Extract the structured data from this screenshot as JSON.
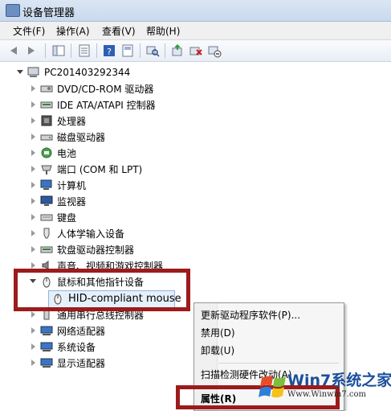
{
  "window": {
    "title": "设备管理器"
  },
  "menu": [
    "文件(F)",
    "操作(A)",
    "查看(V)",
    "帮助(H)"
  ],
  "tree": {
    "root": "PC201403292344",
    "categories": [
      "DVD/CD-ROM 驱动器",
      "IDE ATA/ATAPI 控制器",
      "处理器",
      "磁盘驱动器",
      "电池",
      "端口 (COM 和 LPT)",
      "计算机",
      "监视器",
      "键盘",
      "人体学输入设备",
      "软盘驱动器控制器",
      "声音、视频和游戏控制器",
      "鼠标和其他指针设备",
      "通用串行总线控制器",
      "网络适配器",
      "系统设备",
      "显示适配器"
    ],
    "selected_child": "HID-compliant mouse"
  },
  "context_menu": {
    "items": [
      "更新驱动程序软件(P)...",
      "禁用(D)",
      "卸载(U)",
      "扫描检测硬件改动(A)",
      "属性(R)"
    ]
  },
  "watermark": {
    "brand": "Win7系统之家",
    "url": "Www.Winwin7.com"
  },
  "colors": {
    "highlight_box": "#9c1b1b",
    "selection": "#e6f0fb"
  }
}
